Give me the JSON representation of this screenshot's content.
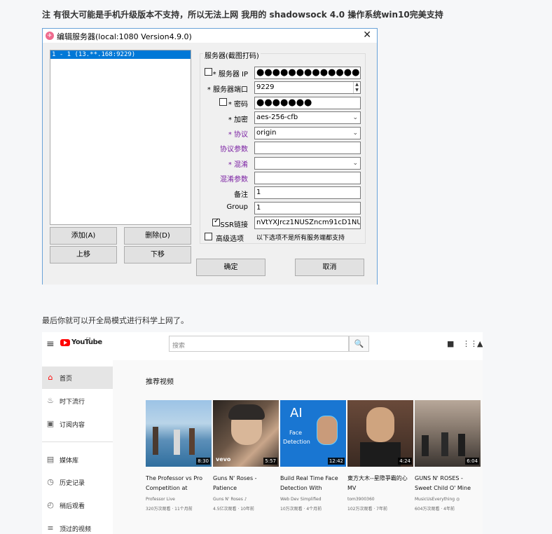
{
  "article": {
    "intro_text": "注 有很大可能是手机升级版本不支持，所以无法上网 我用的 shadowsock 4.0 操作系统win10完美支持",
    "mid_text": "最后你就可以开全局模式进行科学上网了。"
  },
  "dialog": {
    "app_icon": "✈",
    "title": "编辑服务器(local:1080 Version4.9.0)",
    "close_glyph": "✕",
    "server_list": [
      "1 - 1 (13.**.168:9229)"
    ],
    "buttons": {
      "add": "添加(A)",
      "delete": "删除(D)",
      "move_up": "上移",
      "move_down": "下移",
      "ok": "确定",
      "cancel": "取消"
    },
    "group_label": "服务器(截图打码)",
    "fields": {
      "server_ip": {
        "label": "* 服务器 IP",
        "value": "●●●●●●●●●●●●●●",
        "checked": false
      },
      "port": {
        "label": "* 服务器端口",
        "value": "9229"
      },
      "password": {
        "label": "* 密码",
        "value": "●●●●●●●",
        "checked": false
      },
      "encryption": {
        "label": "* 加密",
        "value": "aes-256-cfb"
      },
      "protocol": {
        "label": "* 协议",
        "value": "origin"
      },
      "protocol_param": {
        "label": "协议参数",
        "value": ""
      },
      "obfs": {
        "label": "* 混淆",
        "value": ""
      },
      "obfs_param": {
        "label": "混淆参数",
        "value": ""
      },
      "remarks": {
        "label": "备注",
        "value": "1"
      },
      "group": {
        "label": "Group",
        "value": "1"
      },
      "ssr_link": {
        "label": "SSR链接",
        "value": "nVtYXJrcz1NUSZncm91cD1NUQ",
        "checked": true
      },
      "advanced": {
        "label": "高级选项",
        "checked": false
      }
    },
    "note": "以下选项不是所有服务端都支持",
    "colors": {
      "purple_label": "#7a1fa2",
      "selection": "#0078d7"
    }
  },
  "youtube": {
    "logo_text": "YouTube",
    "region": "CA",
    "search_placeholder": "搜索",
    "search_icon": "🔍",
    "header_icons": [
      "video-camera-icon",
      "apps-grid-icon",
      "bell-icon"
    ],
    "sidebar": [
      {
        "icon": "home-icon",
        "glyph": "⌂",
        "label": "首页",
        "active": true
      },
      {
        "icon": "fire-icon",
        "glyph": "♨",
        "label": "时下流行",
        "active": false
      },
      {
        "icon": "subscriptions-icon",
        "glyph": "▣",
        "label": "订阅内容",
        "active": false
      },
      {
        "icon": "library-icon",
        "glyph": "▤",
        "label": "媒体库",
        "active": false
      },
      {
        "icon": "history-icon",
        "glyph": "◷",
        "label": "历史记录",
        "active": false
      },
      {
        "icon": "watch-later-icon",
        "glyph": "◴",
        "label": "稍后观看",
        "active": false
      },
      {
        "icon": "liked-icon",
        "glyph": "≡",
        "label": "顶过的视频",
        "active": false
      }
    ],
    "section_title": "推荐视频",
    "videos": [
      {
        "title": "The Professor vs Pro Competition at Venice...",
        "channel": "Professor Live",
        "meta": "320万次观看 · 11个月前",
        "duration": "8:30"
      },
      {
        "title": "Guns N' Roses - Patience",
        "channel": "Guns N' Roses ♪",
        "meta": "4.5亿次观看 · 10年前",
        "duration": "5:57"
      },
      {
        "title": "Build Real Time Face Detection With JavaScript",
        "channel": "Web Dev Simplified",
        "meta": "10万次观看 · 4个月前",
        "duration": "12:42"
      },
      {
        "title": "東方大木--星際爭霸的心 MV",
        "channel": "tom3900360",
        "meta": "102万次观看 · 7年前",
        "duration": "4:24"
      },
      {
        "title": "GUNS N' ROSES - Sweet Child O' Mine",
        "channel": "MusicUsEverything ◎",
        "meta": "604万次观看 · 4年前",
        "duration": "6:04"
      }
    ],
    "thumb_texts": {
      "vevo": "vevo",
      "ai_big": "AI",
      "ai_small": "Face Detection"
    },
    "colors": {
      "brand_red": "#ff0000"
    }
  }
}
